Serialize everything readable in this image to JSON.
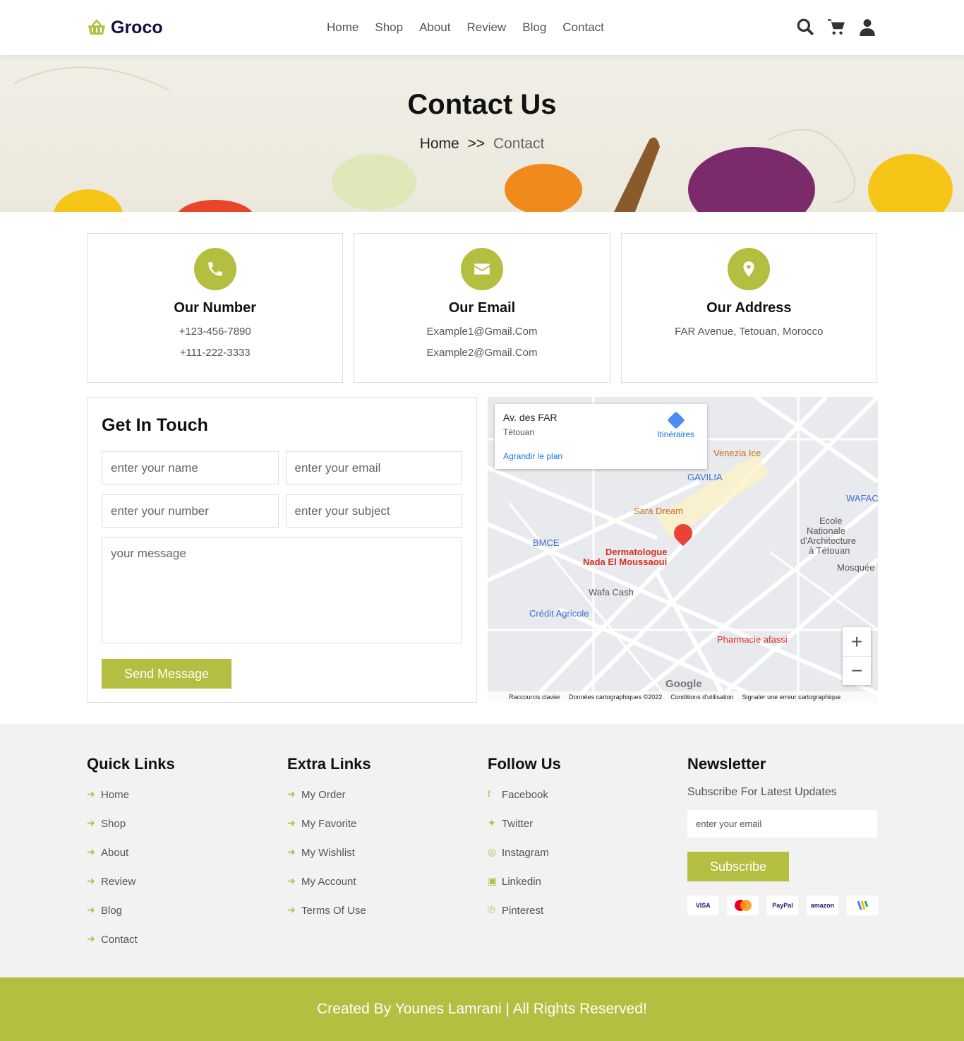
{
  "header": {
    "brand": "Groco",
    "nav": [
      "Home",
      "Shop",
      "About",
      "Review",
      "Blog",
      "Contact"
    ],
    "icons": [
      "search-icon",
      "cart-icon",
      "user-icon"
    ]
  },
  "hero": {
    "title": "Contact Us",
    "crumb_home": "Home",
    "crumb_sep": ">>",
    "crumb_current": "Contact"
  },
  "cards": [
    {
      "icon": "phone-icon",
      "title": "Our Number",
      "lines": [
        "+123-456-7890",
        "+111-222-3333"
      ]
    },
    {
      "icon": "envelope-icon",
      "title": "Our Email",
      "lines": [
        "Example1@Gmail.Com",
        "Example2@Gmail.Com"
      ]
    },
    {
      "icon": "location-pin-icon",
      "title": "Our Address",
      "lines": [
        "FAR Avenue, Tetouan, Morocco"
      ]
    }
  ],
  "form": {
    "title": "Get In Touch",
    "name_placeholder": "enter your name",
    "email_placeholder": "enter your email",
    "number_placeholder": "enter your number",
    "subject_placeholder": "enter your subject",
    "message_placeholder": "your message",
    "submit": "Send Message"
  },
  "map": {
    "place": "Av. des FAR",
    "city": "Tétouan",
    "enlarge": "Agrandir le plan",
    "directions": "Itinéraires",
    "labels": [
      "Venezia Ice",
      "GAVILIA",
      "Sara Dream",
      "BMCE",
      "Dermatologue",
      "Nada El Moussaoui",
      "Wafa Cash",
      "Crédit Agricole",
      "Pharmacie afassi",
      "Ecole",
      "Nationale",
      "d'Architecture",
      "à Tétouan",
      "Mosquée",
      "WAFAC"
    ],
    "footer": [
      "Raccourcis clavier",
      "Données cartographiques ©2022",
      "Conditions d'utilisation",
      "Signaler une erreur cartographique"
    ],
    "logo": "Google",
    "zoom_in": "+",
    "zoom_out": "−"
  },
  "footer": {
    "quick": {
      "title": "Quick Links",
      "items": [
        "Home",
        "Shop",
        "About",
        "Review",
        "Blog",
        "Contact"
      ]
    },
    "extra": {
      "title": "Extra Links",
      "items": [
        "My Order",
        "My Favorite",
        "My Wishlist",
        "My Account",
        "Terms Of Use"
      ]
    },
    "follow": {
      "title": "Follow Us",
      "items": [
        "Facebook",
        "Twitter",
        "Instagram",
        "Linkedin",
        "Pinterest"
      ]
    },
    "newsletter": {
      "title": "Newsletter",
      "subtitle": "Subscribe For Latest Updates",
      "email_placeholder": "enter your email",
      "button": "Subscribe",
      "payments": [
        "VISA",
        "mastercard",
        "PayPal",
        "amazon",
        "google"
      ]
    }
  },
  "credit": "Created By Younes Lamrani | All Rights Reserved!",
  "colors": {
    "accent": "#b4be41",
    "dark": "#130f40"
  }
}
